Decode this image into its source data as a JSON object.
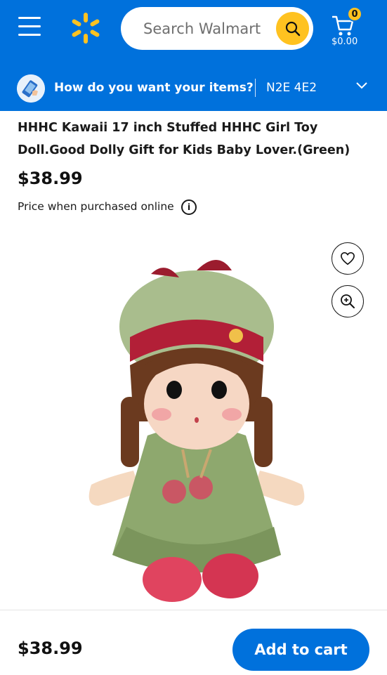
{
  "header": {
    "search_placeholder": "Search Walmart",
    "cart_count": "0",
    "cart_total": "$0.00",
    "icons": {
      "menu": "hamburger-icon",
      "logo": "walmart-spark-icon",
      "search": "search-icon",
      "cart": "cart-icon"
    },
    "colors": {
      "brand_blue": "#0071dc",
      "spark_yellow": "#ffc220"
    }
  },
  "delivery": {
    "question": "How do you want your items?",
    "postal_code": "N2E 4E2"
  },
  "product": {
    "title": "HHHC Kawaii 17 inch Stuffed HHHC Girl Toy Doll.Good Dolly Gift for Kids Baby Lover.(Green)",
    "price": "$38.99",
    "price_note": "Price when purchased online",
    "info_glyph": "i"
  },
  "bottom_bar": {
    "price": "$38.99",
    "add_to_cart_label": "Add to cart"
  }
}
